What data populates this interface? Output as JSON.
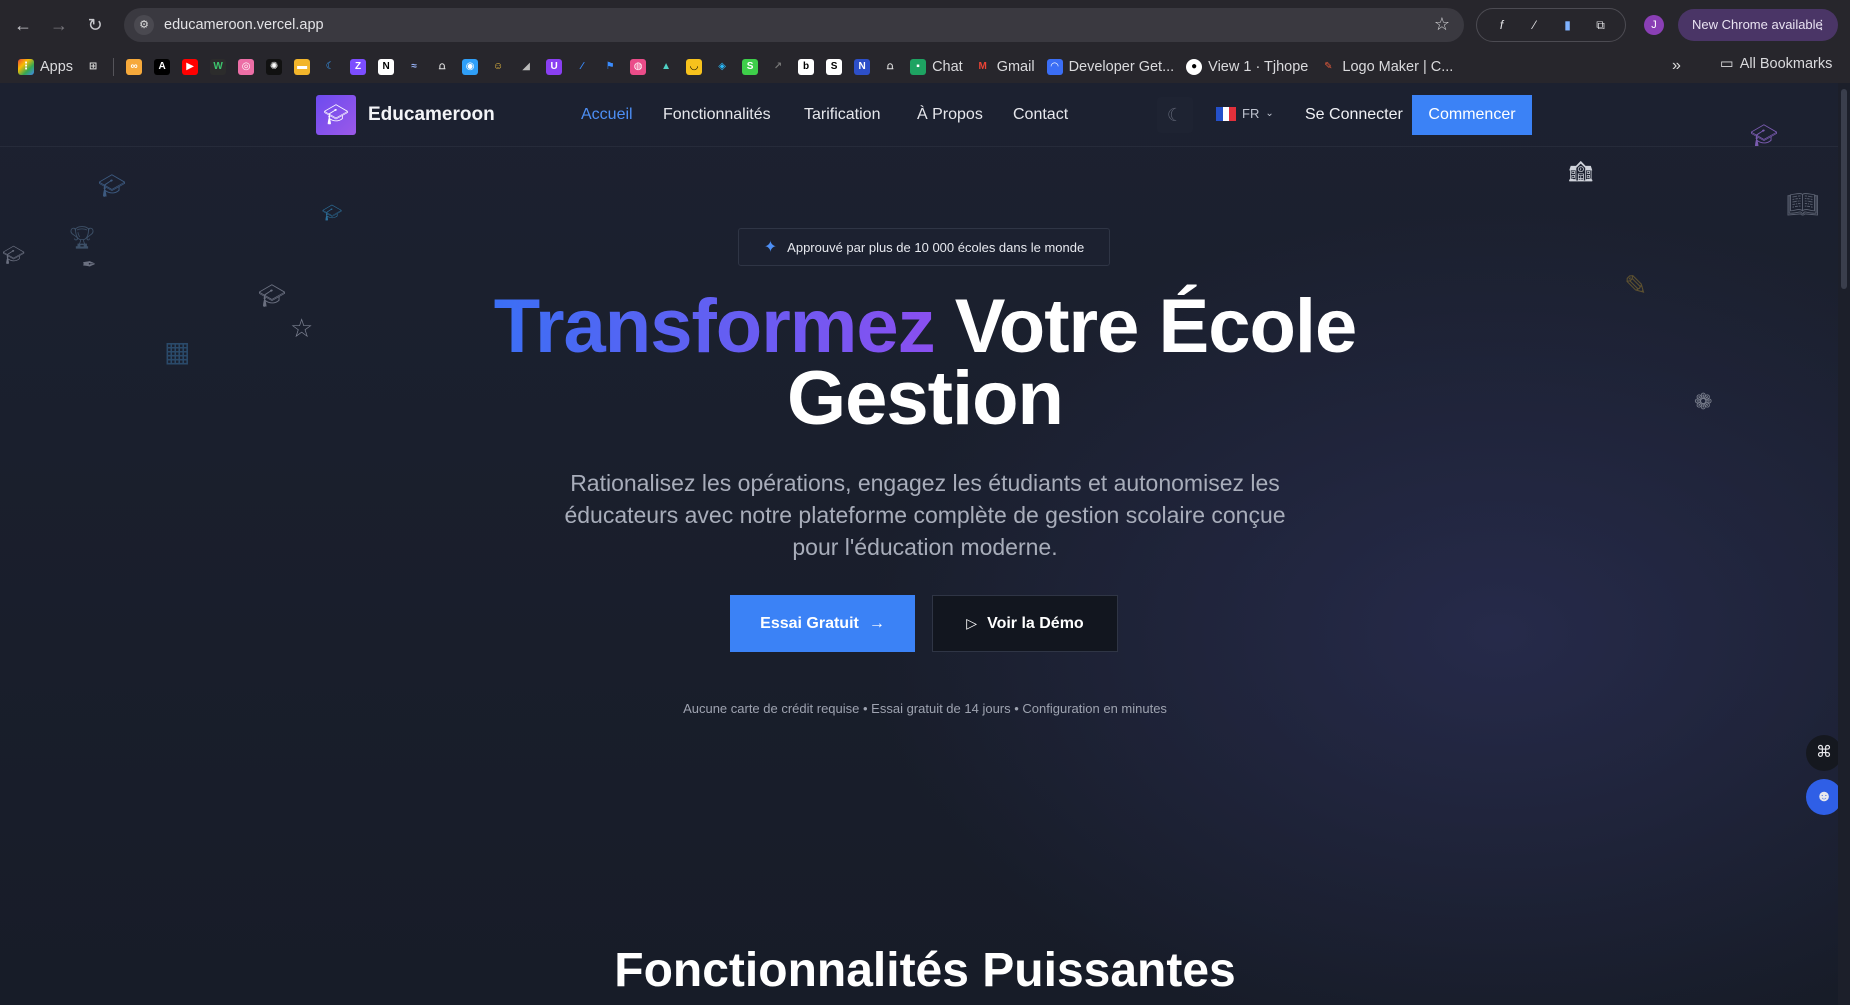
{
  "browser": {
    "url": "educameroon.vercel.app",
    "update_label": "New Chrome available",
    "profile_initial": "J",
    "bookmarks": [
      {
        "label": "Apps",
        "color": "#e94235"
      },
      {
        "label": "Chat",
        "color": "#1ea362"
      },
      {
        "label": "Gmail",
        "color": "#ea4335"
      },
      {
        "label": "Developer Get...",
        "color": "#3b6ef5"
      },
      {
        "label": "View 1 · Tjhope",
        "color": "#ffffff"
      },
      {
        "label": "Logo Maker | C...",
        "color": "#e55a3c"
      }
    ],
    "all_bookmarks_label": "All Bookmarks"
  },
  "nav": {
    "brand": "Educameroon",
    "links": [
      "Accueil",
      "Fonctionnalités",
      "Tarification",
      "À Propos",
      "Contact"
    ],
    "lang": "FR",
    "login": "Se Connecter",
    "cta": "Commencer"
  },
  "hero": {
    "badge": "Approuvé par plus de 10 000 écoles dans le monde",
    "title_gradient": "Transformez",
    "title_rest": " Votre École",
    "title_line2": "Gestion",
    "subtitle": "Rationalisez les opérations, engagez les étudiants et autonomisez les éducateurs avec notre plateforme complète de gestion scolaire conçue pour l'éducation moderne.",
    "primary_button": "Essai Gratuit",
    "secondary_button": "Voir la Démo",
    "fine_print": "Aucune carte de crédit requise • Essai gratuit de 14 jours • Configuration en minutes"
  },
  "features": {
    "title": "Fonctionnalités Puissantes"
  },
  "colors": {
    "accent": "#3b82f6",
    "gradient_start": "#3b6ff5",
    "gradient_end": "#8a4ff0",
    "background": "#1b1f2c"
  }
}
